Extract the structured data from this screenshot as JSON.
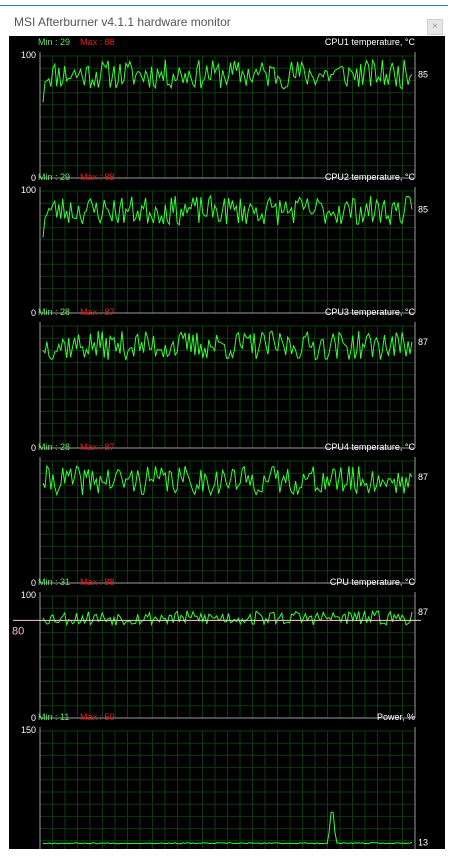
{
  "window": {
    "title": "MSI Afterburner v4.1.1 hardware monitor",
    "close_label": "×"
  },
  "colors": {
    "background": "#000000",
    "grid": "#0b3a0b",
    "axis": "#9a9a9a",
    "trace": "#33ff33",
    "min_label": "#66e066",
    "max_label": "#e02020",
    "title_label": "#ffffff",
    "threshold_line": "#ffc8c8",
    "threshold_label": "#ffc0c0"
  },
  "graphs": [
    {
      "name": "cpu1-temperature",
      "title": "CPU1 temperature, °C",
      "min_label": "Min : 29",
      "max_label": "Max : 88",
      "y_max_label": "100",
      "y_min_label": "0",
      "y_max": 100,
      "current_value": "85",
      "current": 85,
      "level": 85,
      "amplitude": 12,
      "start_value": 62,
      "seed": 11
    },
    {
      "name": "cpu2-temperature",
      "title": "CPU2 temperature, °C",
      "min_label": "Min : 29",
      "max_label": "Max : 88",
      "y_max_label": "100",
      "y_min_label": "0",
      "y_max": 100,
      "current_value": "85",
      "current": 85,
      "level": 84,
      "amplitude": 12,
      "start_value": 62,
      "seed": 23
    },
    {
      "name": "cpu3-temperature",
      "title": "CPU3 temperature, °C",
      "min_label": "Min : 28",
      "max_label": "Max : 87",
      "y_max_label": "",
      "y_min_label": "0",
      "y_max": 100,
      "current_value": "87",
      "current": 87,
      "level": 84,
      "amplitude": 12,
      "start_value": 80,
      "seed": 37
    },
    {
      "name": "cpu4-temperature",
      "title": "CPU4 temperature, °C",
      "min_label": "Min : 28",
      "max_label": "Max : 87",
      "y_max_label": "",
      "y_min_label": "0",
      "y_max": 100,
      "current_value": "87",
      "current": 87,
      "level": 84,
      "amplitude": 12,
      "start_value": 82,
      "seed": 41
    },
    {
      "name": "cpu-temperature",
      "title": "CPU temperature, °C",
      "min_label": "Min : 31",
      "max_label": "Max : 88",
      "y_max_label": "100",
      "y_min_label": "0",
      "y_max": 100,
      "current_value": "87",
      "current": 87,
      "level": 82,
      "amplitude": 6,
      "start_value": 82,
      "seed": 53,
      "threshold_value": 80,
      "threshold_label": "80"
    },
    {
      "name": "power",
      "title": "Power, %",
      "min_label": "Min : 11",
      "max_label": "Max : 50",
      "y_max_label": "150",
      "y_min_label": "0",
      "y_max": 150,
      "current_value": "13",
      "current": 13,
      "level": 12,
      "amplitude": 0.6,
      "start_value": 12,
      "seed": 67,
      "spike_at": 0.78,
      "spike_value": 50
    }
  ]
}
